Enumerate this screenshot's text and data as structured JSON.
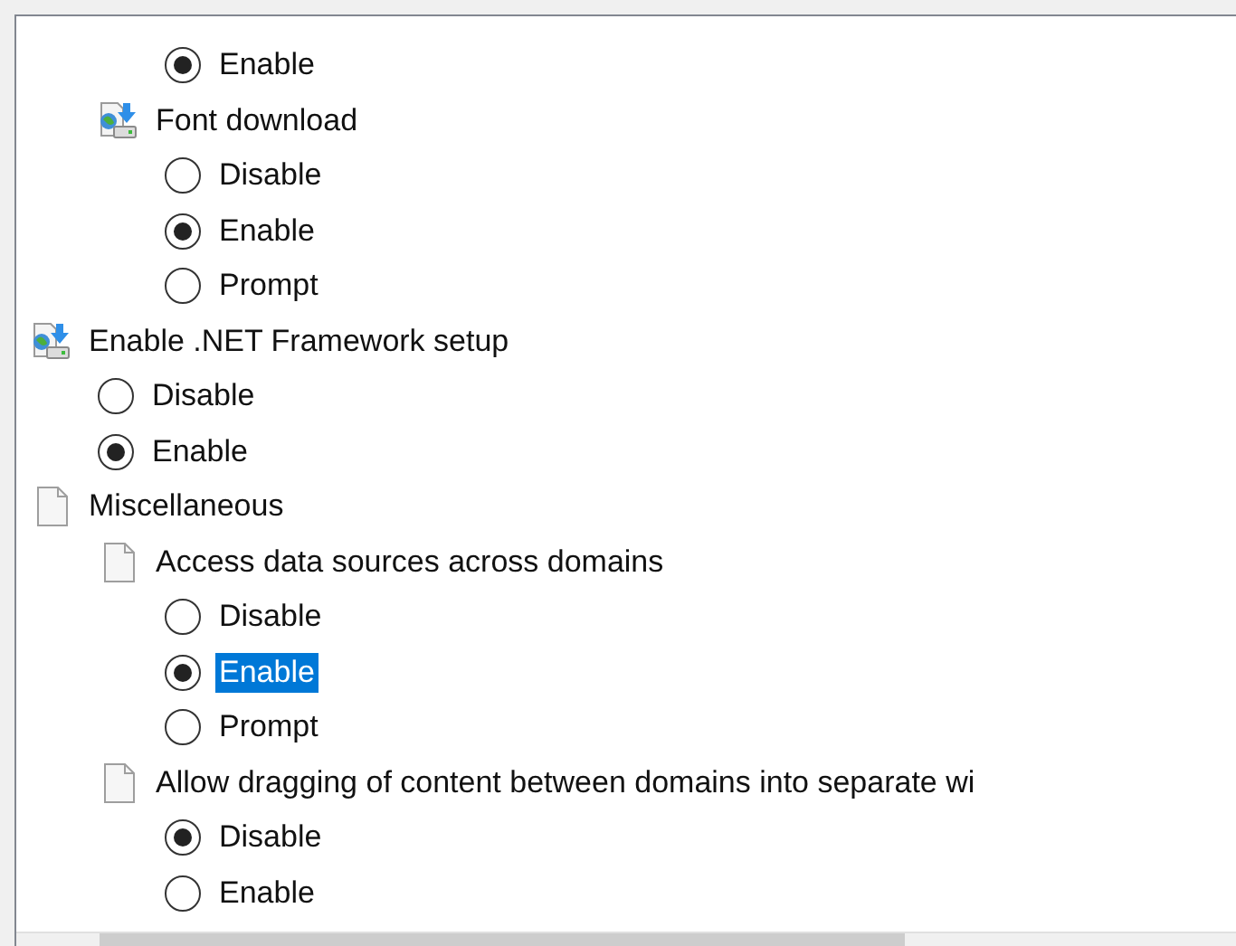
{
  "tree": [
    {
      "kind": "group",
      "children": [
        {
          "kind": "group",
          "children": [
            {
              "kind": "radio",
              "label": "Enable",
              "selected": true,
              "highlighted": false
            }
          ]
        },
        {
          "kind": "policy",
          "label": "Font download",
          "children": [
            {
              "kind": "radio",
              "label": "Disable",
              "selected": false,
              "highlighted": false
            },
            {
              "kind": "radio",
              "label": "Enable",
              "selected": true,
              "highlighted": false
            },
            {
              "kind": "radio",
              "label": "Prompt",
              "selected": false,
              "highlighted": false
            }
          ]
        }
      ]
    },
    {
      "kind": "policy",
      "label": "Enable .NET Framework setup",
      "children": [
        {
          "kind": "radio",
          "label": "Disable",
          "selected": false,
          "highlighted": false
        },
        {
          "kind": "radio",
          "label": "Enable",
          "selected": true,
          "highlighted": false
        }
      ]
    },
    {
      "kind": "page",
      "label": "Miscellaneous",
      "children": [
        {
          "kind": "page",
          "label": "Access data sources across domains",
          "children": [
            {
              "kind": "radio",
              "label": "Disable",
              "selected": false,
              "highlighted": false
            },
            {
              "kind": "radio",
              "label": "Enable",
              "selected": true,
              "highlighted": true
            },
            {
              "kind": "radio",
              "label": "Prompt",
              "selected": false,
              "highlighted": false
            }
          ]
        },
        {
          "kind": "page",
          "label": "Allow dragging of content between domains into separate wi",
          "children": [
            {
              "kind": "radio",
              "label": "Disable",
              "selected": true,
              "highlighted": false
            },
            {
              "kind": "radio",
              "label": "Enable",
              "selected": false,
              "highlighted": false
            }
          ]
        }
      ]
    }
  ]
}
